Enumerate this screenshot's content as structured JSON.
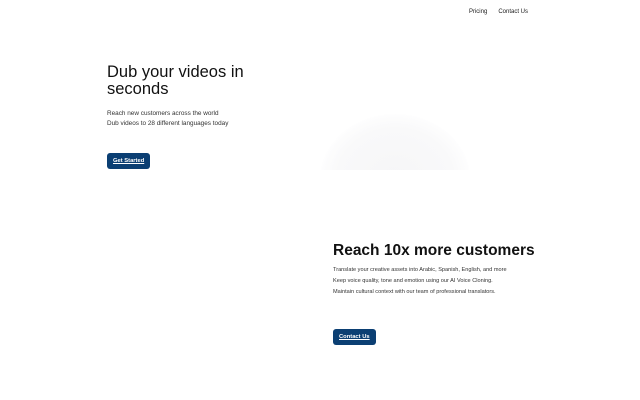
{
  "nav": {
    "items": [
      {
        "label": "Pricing"
      },
      {
        "label": "Contact Us"
      }
    ]
  },
  "hero": {
    "title": "Dub your videos in seconds",
    "subtitle_lines": [
      "Reach new customers across the world",
      "Dub videos to 28 different languages today"
    ],
    "cta_label": "Get Started"
  },
  "section2": {
    "title": "Reach 10x more customers",
    "lines": [
      "Translate your creative assets into Arabic, Spanish, English, and more",
      "Keep voice quality, tone and emotion using our AI Voice Cloning.",
      "Maintain cultural context with our team of professional translators."
    ],
    "cta_label": "Contact Us"
  },
  "colors": {
    "button_bg": "#0b3f73",
    "button_text": "#ffffff",
    "background": "#ffffff"
  }
}
